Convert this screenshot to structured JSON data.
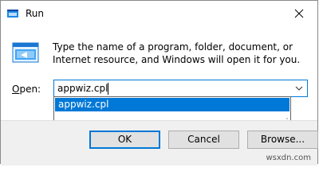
{
  "window": {
    "title": "Run"
  },
  "main": {
    "description": "Type the name of a program, folder, document, or Internet resource, and Windows will open it for you.",
    "open_label_prefix": "O",
    "open_label_suffix": "pen:",
    "input_value": "appwiz.cpl",
    "dropdown_items": [
      "appwiz.cpl"
    ]
  },
  "buttons": {
    "ok": "OK",
    "cancel": "Cancel",
    "browse": "Browse..."
  },
  "watermark": "wsxdn.com",
  "colors": {
    "accent": "#0078d7",
    "dialog_bg": "#f0f0f0"
  },
  "icons": [
    "run-app-icon",
    "close-icon",
    "run-program-icon",
    "chevron-down-icon",
    "resize-grip-icon"
  ]
}
